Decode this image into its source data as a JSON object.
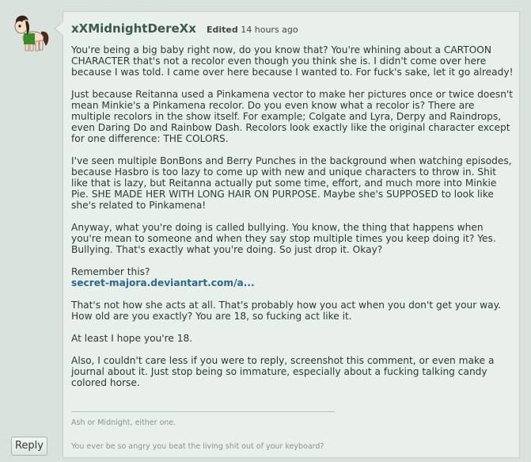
{
  "comment": {
    "username": "xXMidnightDereXx",
    "edited_label": "Edited",
    "timestamp": "14 hours ago",
    "paragraphs": [
      "You're being a big baby right now, do you know that? You're whining about a CARTOON CHARACTER that's not a recolor even though you think she is. I didn't come over here because I was told. I came over here because I wanted to. For fuck's sake, let it go already!",
      "Just because Reitanna used a Pinkamena vector to make her pictures once or twice doesn't mean Minkie's a Pinkamena recolor. Do you even know what a recolor is? There are multiple recolors in the show itself. For example; Colgate and Lyra, Derpy and Raindrops, even Daring Do and Rainbow Dash. Recolors look exactly like the original character except for one difference: THE COLORS.",
      "I've seen multiple BonBons and Berry Punches in the background when watching episodes, because Hasbro is too lazy to come up with new and unique characters to throw in. Shit like that is lazy, but Reitanna actually put some time, effort, and much more into Minkie Pie. SHE MADE HER WITH LONG HAIR ON PURPOSE. Maybe she's SUPPOSED to look like she's related to Pinkamena!",
      "Anyway, what you're doing is called bullying. You know, the thing that happens when you're mean to someone and when they say stop multiple times you keep doing it? Yes. Bullying. That's exactly what you're doing. So just drop it. Okay?"
    ],
    "remember_text": "Remember this?",
    "link_text": "secret-majora.deviantart.com/a...",
    "paragraphs_after": [
      "That's not how she acts at all. That's probably how you act when you don't get your way. How old are you exactly? You are 18, so fucking act like it.",
      "At least I hope you're 18.",
      "Also, I couldn't care less if you were to reply, screenshot this comment, or even make a journal about it. Just stop being so immature, especially about a fucking talking candy colored horse."
    ],
    "signature_line1": "Ash or Midnight, either one.",
    "signature_line2": "You ever be so angry you beat the living shit out of your keyboard?"
  },
  "actions": {
    "reply_label": "Reply"
  },
  "colors": {
    "page_bg": "#d9e2dc",
    "comment_bg": "#e9efea",
    "username": "#3b5a4f",
    "link": "#2b6a8c"
  }
}
